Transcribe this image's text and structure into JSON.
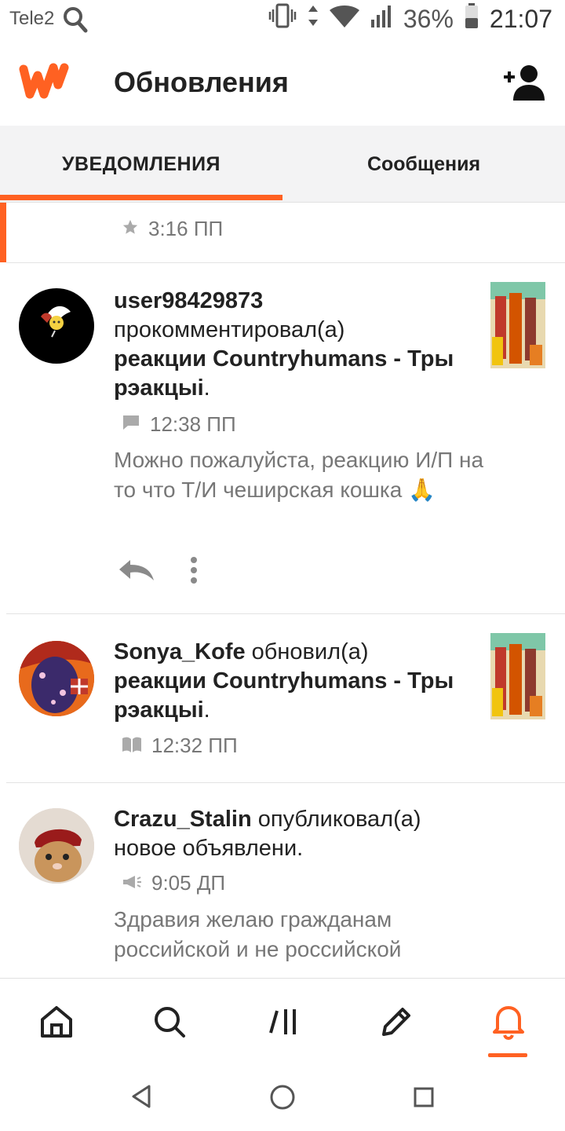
{
  "status_bar": {
    "carrier": "Tele2",
    "battery": "36%",
    "time": "21:07"
  },
  "header": {
    "title": "Обновления"
  },
  "tabs": [
    {
      "label": "УВЕДОМЛЕНИЯ",
      "active": true
    },
    {
      "label": "Сообщения",
      "active": false
    }
  ],
  "accent_color": "#ff6122",
  "feed": {
    "stub_time": "3:16 ПП",
    "items": [
      {
        "user": "user98429873",
        "action": "прокомментировал(а)",
        "story": "реакции Countryhumans - Тры рэакцыі",
        "suffix": ".",
        "time": "12:38 ПП",
        "meta_icon": "comment-icon",
        "quote": "Можно пожалуйста, реакцию И/П на то что Т/И чеширская кошка 🙏"
      },
      {
        "user": "Sonya_Kofe",
        "action": "обновил(а)",
        "story": "реакции Countryhumans - Тры рэакцыі",
        "suffix": ".",
        "time": "12:32 ПП",
        "meta_icon": "book-icon"
      },
      {
        "user": "Crazu_Stalin",
        "action": "опубликовал(а) новое объявлени.",
        "time": "9:05 ДП",
        "meta_icon": "megaphone-icon",
        "quote": "Здравия желаю гражданам российской и не российской"
      }
    ]
  },
  "bottom_nav": [
    "home-icon",
    "search-icon",
    "library-icon",
    "write-icon",
    "notifications-icon"
  ],
  "system_nav": [
    "back-icon",
    "home-circle-icon",
    "recents-icon"
  ]
}
